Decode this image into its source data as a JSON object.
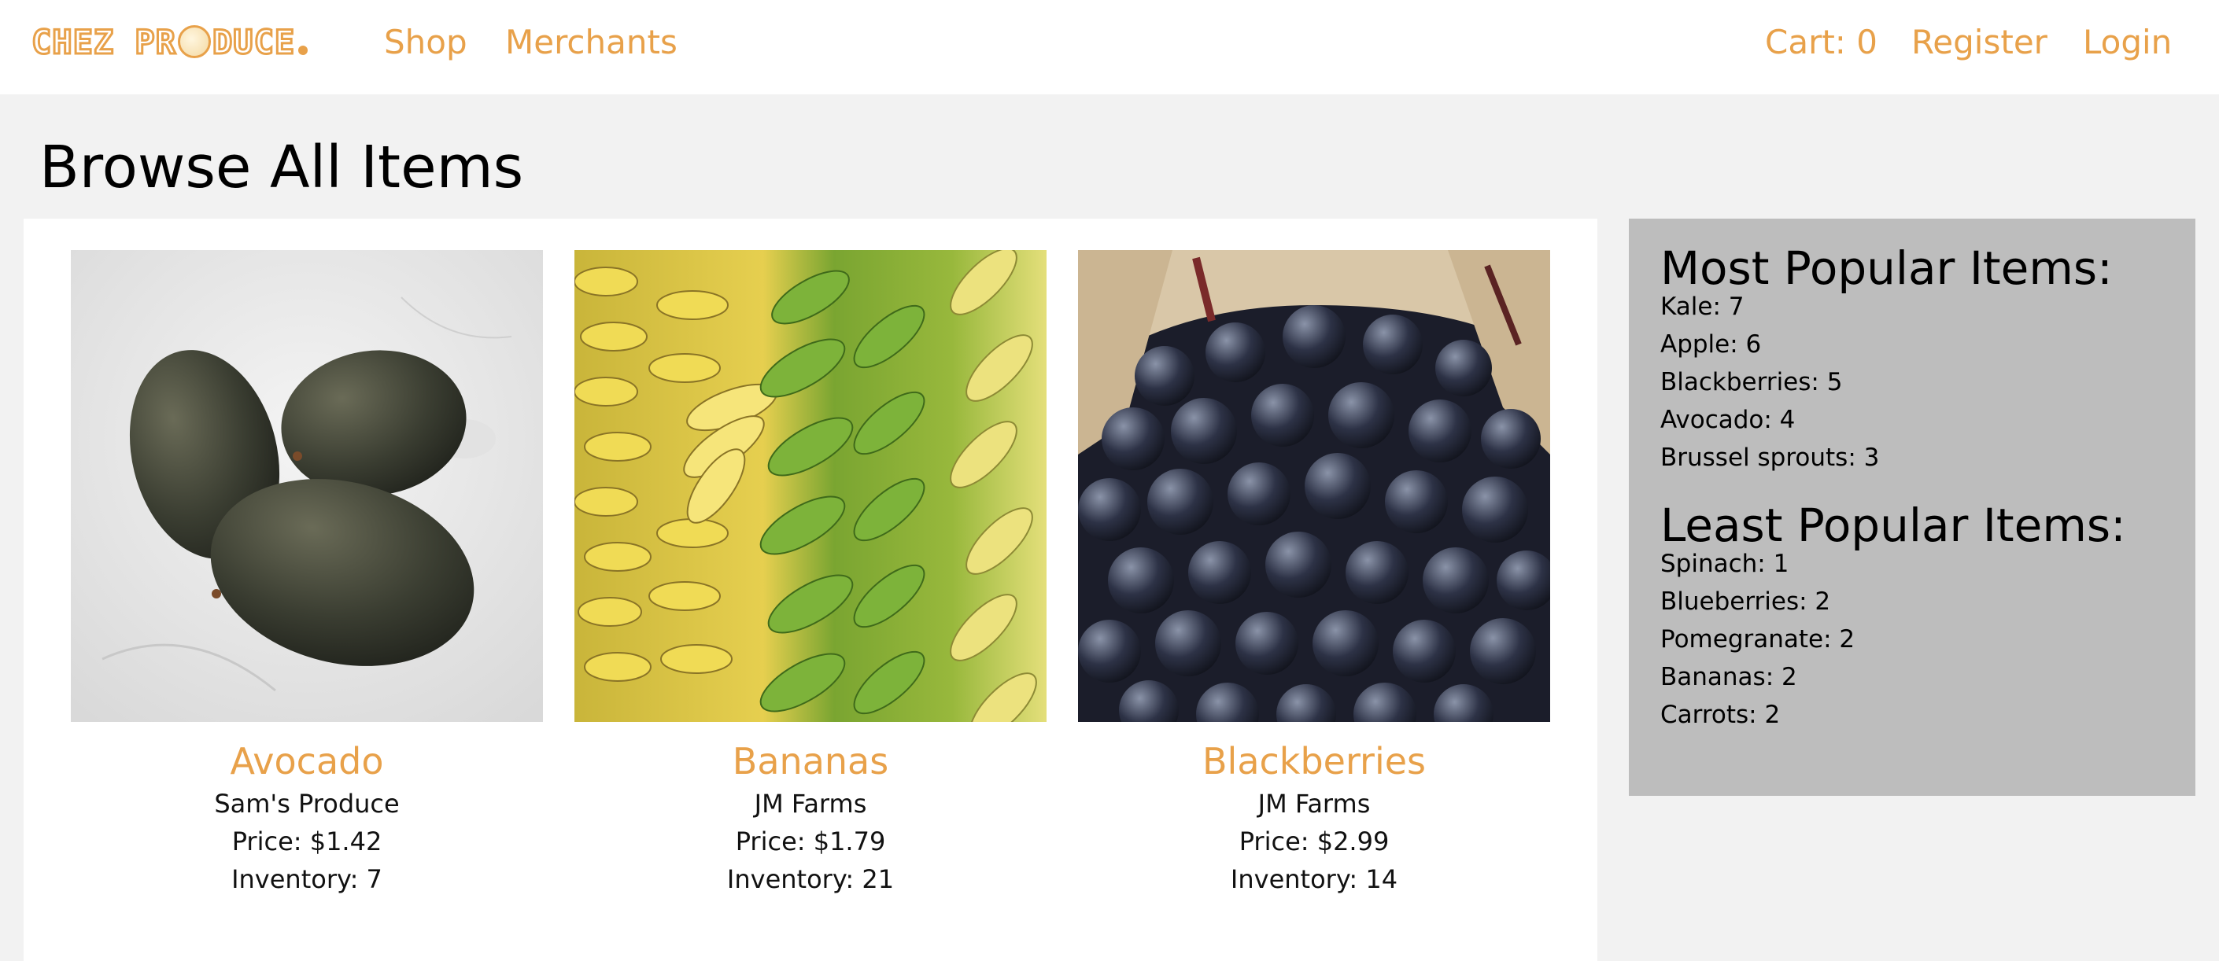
{
  "header": {
    "logo_text": "CHEZ PRODUCE",
    "nav_left": [
      "Shop",
      "Merchants"
    ],
    "cart_label": "Cart: 0",
    "register_label": "Register",
    "login_label": "Login"
  },
  "page_title": "Browse All Items",
  "items": [
    {
      "name": "Avocado",
      "merchant": "Sam's Produce",
      "price": "Price: $1.42",
      "inventory": "Inventory: 7",
      "image": "avocado-photo"
    },
    {
      "name": "Bananas",
      "merchant": "JM Farms",
      "price": "Price: $1.79",
      "inventory": "Inventory: 21",
      "image": "bananas-photo"
    },
    {
      "name": "Blackberries",
      "merchant": "JM Farms",
      "price": "Price: $2.99",
      "inventory": "Inventory: 14",
      "image": "blackberries-photo"
    }
  ],
  "stats": {
    "most_title": "Most Popular Items:",
    "most": [
      "Kale: 7",
      "Apple: 6",
      "Blackberries: 5",
      "Avocado: 4",
      "Brussel sprouts: 3"
    ],
    "least_title": "Least Popular Items:",
    "least": [
      "Spinach: 1",
      "Blueberries: 2",
      "Pomegranate: 2",
      "Bananas: 2",
      "Carrots: 2"
    ]
  },
  "colors": {
    "accent": "#e8a14a",
    "stats_bg": "#bdbdbd",
    "page_bg": "#f2f2f2"
  }
}
